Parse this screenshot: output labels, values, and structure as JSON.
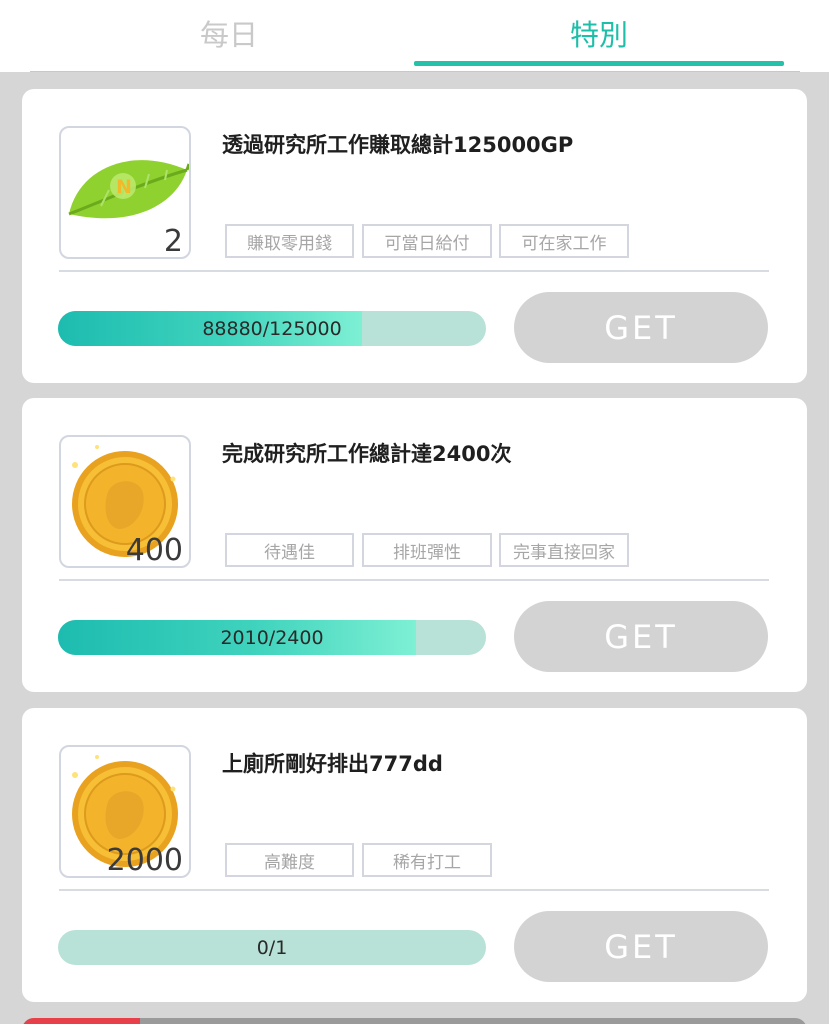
{
  "tabs": [
    {
      "label": "每日",
      "active": false
    },
    {
      "label": "特別",
      "active": true
    }
  ],
  "accent_color": "#26c1aa",
  "missions": [
    {
      "reward_icon": "leaf-icon",
      "reward_count": "2",
      "title": "透過研究所工作賺取總計125000GP",
      "tags": [
        "賺取零用錢",
        "可當日給付",
        "可在家工作"
      ],
      "progress_text": "88880/125000",
      "progress_fraction": 0.711,
      "button_label": "GET"
    },
    {
      "reward_icon": "gold-coin-icon",
      "reward_count": "400",
      "title": "完成研究所工作總計達2400次",
      "tags": [
        "待遇佳",
        "排班彈性",
        "完事直接回家"
      ],
      "progress_text": "2010/2400",
      "progress_fraction": 0.8375,
      "button_label": "GET"
    },
    {
      "reward_icon": "gold-coin-icon",
      "reward_count": "2000",
      "title": "上廁所剛好排出777dd",
      "tags": [
        "高難度",
        "稀有打工"
      ],
      "progress_text": "0/1",
      "progress_fraction": 0,
      "button_label": "GET"
    }
  ]
}
